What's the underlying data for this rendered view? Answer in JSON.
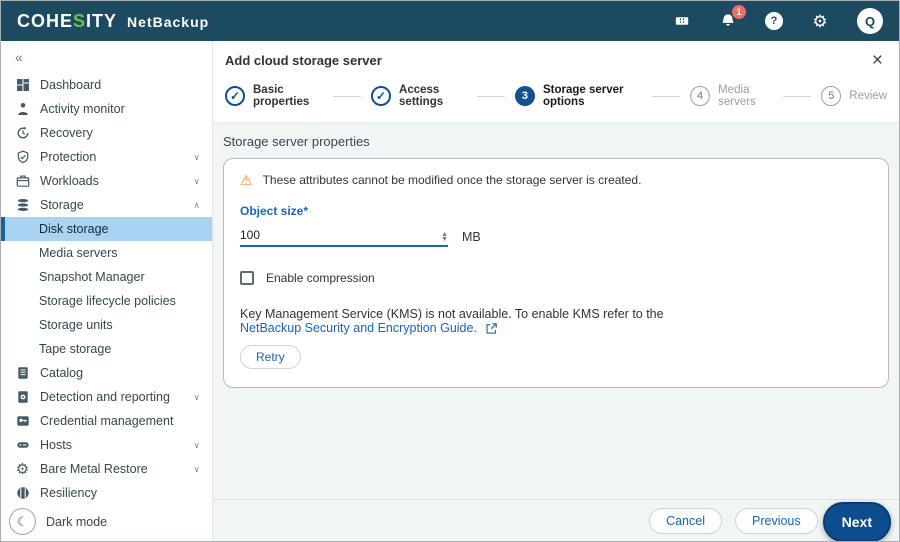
{
  "header": {
    "logo_pre": "COHE",
    "logo_accent": "S",
    "logo_post": "ITY",
    "product": "NetBackup",
    "notification_count": "1",
    "help_glyph": "?",
    "avatar_initial": "Q"
  },
  "sidebar": {
    "collapse_glyph": "«",
    "items": [
      {
        "label": "Dashboard",
        "icon": "dashboard-icon"
      },
      {
        "label": "Activity monitor",
        "icon": "activity-monitor-icon"
      },
      {
        "label": "Recovery",
        "icon": "recovery-icon"
      },
      {
        "label": "Protection",
        "icon": "shield-check-icon",
        "expandable": true
      },
      {
        "label": "Workloads",
        "icon": "briefcase-icon",
        "expandable": true
      },
      {
        "label": "Storage",
        "icon": "storage-stack-icon",
        "expandable": true,
        "expanded": true
      },
      {
        "label": "Disk storage",
        "sub": true,
        "selected": true
      },
      {
        "label": "Media servers",
        "sub": true
      },
      {
        "label": "Snapshot Manager",
        "sub": true
      },
      {
        "label": "Storage lifecycle policies",
        "sub": true
      },
      {
        "label": "Storage units",
        "sub": true
      },
      {
        "label": "Tape storage",
        "sub": true
      },
      {
        "label": "Catalog",
        "icon": "catalog-book-icon"
      },
      {
        "label": "Detection and reporting",
        "icon": "detection-doc-icon",
        "expandable": true
      },
      {
        "label": "Credential management",
        "icon": "credential-key-icon"
      },
      {
        "label": "Hosts",
        "icon": "hosts-server-icon",
        "expandable": true
      },
      {
        "label": "Bare Metal Restore",
        "icon": "gear-icon",
        "expandable": true
      },
      {
        "label": "Resiliency",
        "icon": "resiliency-icon"
      }
    ],
    "dark_mode_label": "Dark mode"
  },
  "wizard": {
    "title": "Add cloud storage server",
    "steps": [
      {
        "number": "1",
        "label": "Basic properties",
        "state": "complete"
      },
      {
        "number": "2",
        "label": "Access settings",
        "state": "complete"
      },
      {
        "number": "3",
        "label": "Storage server options",
        "state": "active"
      },
      {
        "number": "4",
        "label": "Media servers",
        "state": "upcoming"
      },
      {
        "number": "5",
        "label": "Review",
        "state": "upcoming"
      }
    ],
    "check_glyph": "✓"
  },
  "content": {
    "section_title": "Storage server properties",
    "warning_text": "These attributes cannot be modified once the storage server is created.",
    "object_size_label": "Object size*",
    "object_size_value": "100",
    "object_size_unit": "MB",
    "compression_label": "Enable compression",
    "kms_text": "Key Management Service (KMS) is not available. To enable KMS refer to the",
    "kms_link_label": "NetBackup Security and Encryption Guide.",
    "retry_label": "Retry"
  },
  "footer": {
    "cancel_label": "Cancel",
    "previous_label": "Previous",
    "next_label": "Next"
  },
  "colors": {
    "header_bg": "#1c4b61",
    "accent_green": "#6cc04a",
    "primary_blue": "#11518f",
    "link_blue": "#1565c0",
    "next_button_blue": "#0d4d8f",
    "selected_item_bg": "#a8d3f1",
    "warning_orange": "#f1902d",
    "badge_red": "#ea6d66",
    "body_bg": "#f1f5f6"
  }
}
